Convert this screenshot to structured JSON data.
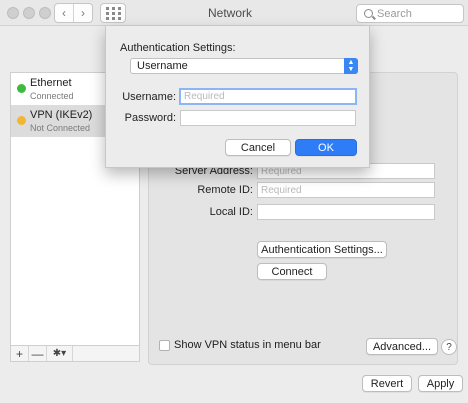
{
  "window": {
    "title": "Network",
    "back_icon": "‹",
    "forward_icon": "›",
    "search_placeholder": "Search"
  },
  "sidebar": {
    "items": [
      {
        "name": "Ethernet",
        "status": "Connected",
        "dot_color": "#3dbb3d"
      },
      {
        "name": "VPN (IKEv2)",
        "status": "Not Connected",
        "dot_color": "#f2b632"
      }
    ],
    "add": "+",
    "remove": "—",
    "gear": "✱▾"
  },
  "main": {
    "server_address_label": "Server Address:",
    "server_address_placeholder": "Required",
    "remote_id_label": "Remote ID:",
    "remote_id_placeholder": "Required",
    "local_id_label": "Local ID:",
    "local_id_value": "",
    "auth_settings_button": "Authentication Settings...",
    "connect_button": "Connect",
    "show_status_label": "Show VPN status in menu bar",
    "show_status_checked": false,
    "advanced_button": "Advanced...",
    "help": "?"
  },
  "footer": {
    "revert_button": "Revert",
    "apply_button": "Apply"
  },
  "dialog": {
    "title": "Authentication Settings:",
    "method_selected": "Username",
    "username_label": "Username:",
    "username_placeholder": "Required",
    "password_label": "Password:",
    "password_value": "",
    "cancel_button": "Cancel",
    "ok_button": "OK",
    "accent": "#2f7df6"
  }
}
